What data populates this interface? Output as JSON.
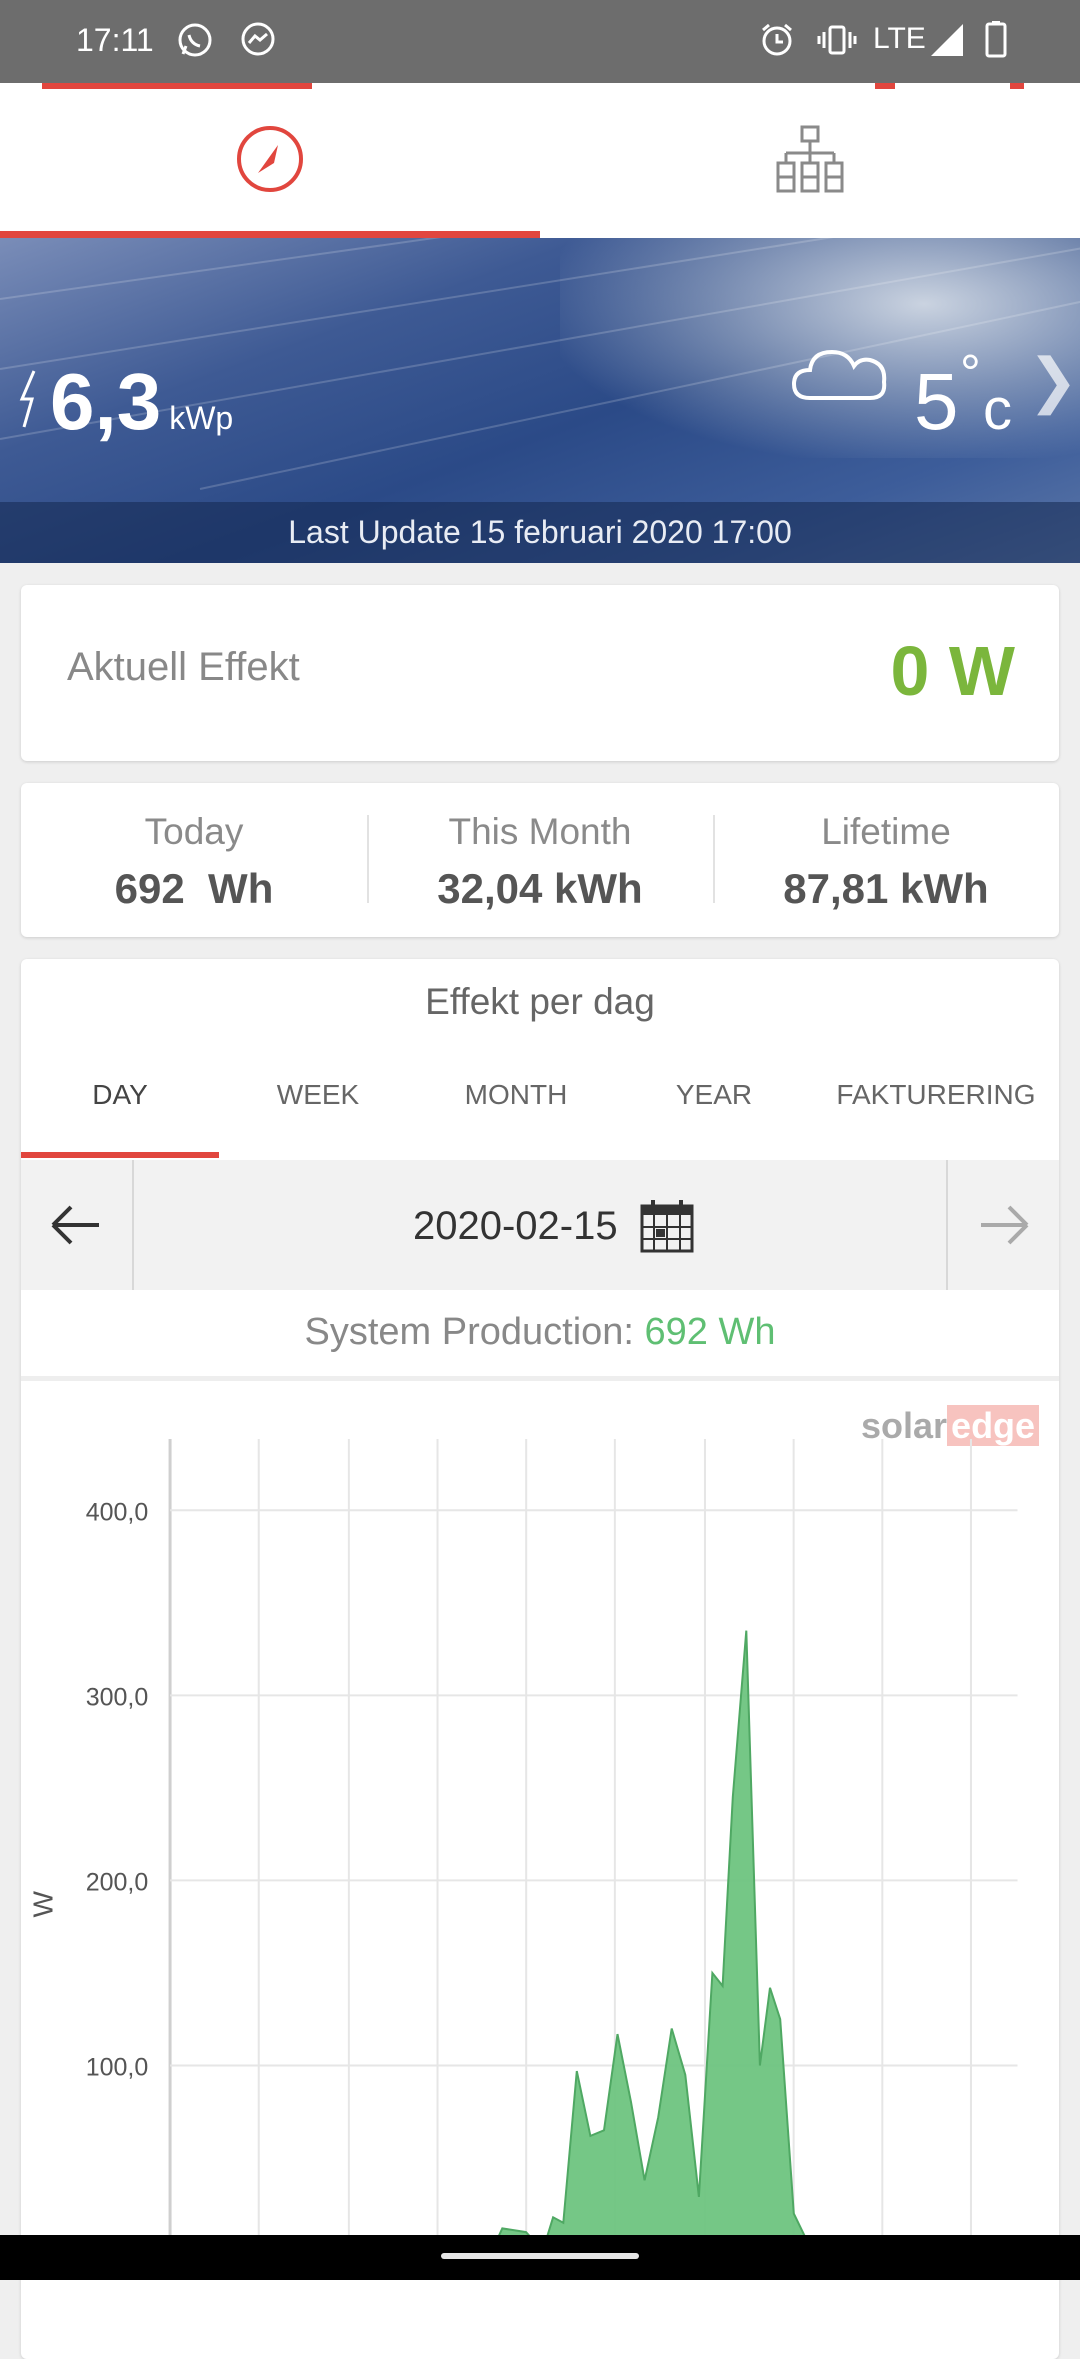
{
  "status_bar": {
    "time": "17:11",
    "network": "LTE",
    "icons": [
      "whatsapp-icon",
      "messenger-icon",
      "alarm-icon",
      "vibrate-icon",
      "signal-icon",
      "battery-icon"
    ]
  },
  "top_tabs": [
    {
      "icon": "dashboard-gauge-icon",
      "active": true
    },
    {
      "icon": "site-layout-icon",
      "active": false
    }
  ],
  "banner": {
    "power_rating_value": "6,3",
    "power_rating_unit": "kWp",
    "temperature_value": "5",
    "temperature_unit": "c",
    "temperature_degree": "°",
    "weather_icon": "cloud-icon",
    "last_update": "Last Update 15 februari 2020 17:00"
  },
  "current_power": {
    "label": "Aktuell Effekt",
    "value": "0 W"
  },
  "energy": [
    {
      "title": "Today",
      "value": "692  Wh"
    },
    {
      "title": "This Month",
      "value": "32,04 kWh"
    },
    {
      "title": "Lifetime",
      "value": "87,81 kWh"
    }
  ],
  "chart_card": {
    "title": "Effekt per dag",
    "tabs": [
      "DAY",
      "WEEK",
      "MONTH",
      "YEAR",
      "FAKTURERING"
    ],
    "active_tab": "DAY",
    "date": "2020-02-15",
    "system_production_label": "System Production:",
    "system_production_value": "692 Wh",
    "logo_text_1": "solar",
    "logo_text_2": "edge"
  },
  "colors": {
    "accent": "#e1463e",
    "power_green": "#7bb63c",
    "chart_green": "#5fbf73"
  },
  "chart_data": {
    "type": "area",
    "ylabel": "W",
    "y_ticks": [
      "400,0",
      "300,0",
      "200,0",
      "100,0"
    ],
    "ylim": [
      0,
      440
    ],
    "x": [
      0,
      1,
      2,
      3,
      4,
      5,
      6,
      7,
      8,
      9,
      10,
      11,
      12,
      13,
      14,
      15,
      16,
      17,
      18,
      19,
      20,
      21,
      22,
      23,
      24,
      25,
      26,
      27,
      28,
      29,
      30,
      31,
      32,
      33,
      34,
      35,
      36,
      37,
      38,
      39,
      40,
      41,
      42,
      43,
      44,
      45,
      46,
      47,
      48,
      49,
      50
    ],
    "series": [
      {
        "values": [
          0,
          0,
          0,
          0,
          0,
          0,
          0,
          0,
          0,
          0,
          0,
          0,
          0,
          0,
          0,
          0,
          0,
          0,
          0,
          0,
          0,
          0,
          0,
          0,
          0,
          0,
          0,
          0,
          0,
          0,
          0,
          0,
          0,
          0,
          0,
          0,
          0,
          0,
          0,
          0,
          0,
          0,
          0,
          0,
          0,
          0,
          0,
          0,
          0,
          0,
          0
        ]
      }
    ],
    "profile": [
      [
        0,
        0
      ],
      [
        19,
        0
      ],
      [
        19.6,
        12
      ],
      [
        21,
        10
      ],
      [
        22,
        0
      ],
      [
        22.6,
        18
      ],
      [
        23.2,
        15
      ],
      [
        24,
        97
      ],
      [
        24.8,
        62
      ],
      [
        25.6,
        65
      ],
      [
        26.4,
        117
      ],
      [
        27.2,
        80
      ],
      [
        28,
        38
      ],
      [
        28.8,
        72
      ],
      [
        29.6,
        120
      ],
      [
        30.4,
        95
      ],
      [
        31.2,
        29
      ],
      [
        32,
        150
      ],
      [
        32.6,
        143
      ],
      [
        33.2,
        245
      ],
      [
        34,
        335
      ],
      [
        34.8,
        100
      ],
      [
        35.4,
        142
      ],
      [
        36,
        125
      ],
      [
        36.8,
        20
      ],
      [
        37.6,
        5
      ],
      [
        38.4,
        0
      ],
      [
        50,
        0
      ]
    ]
  }
}
